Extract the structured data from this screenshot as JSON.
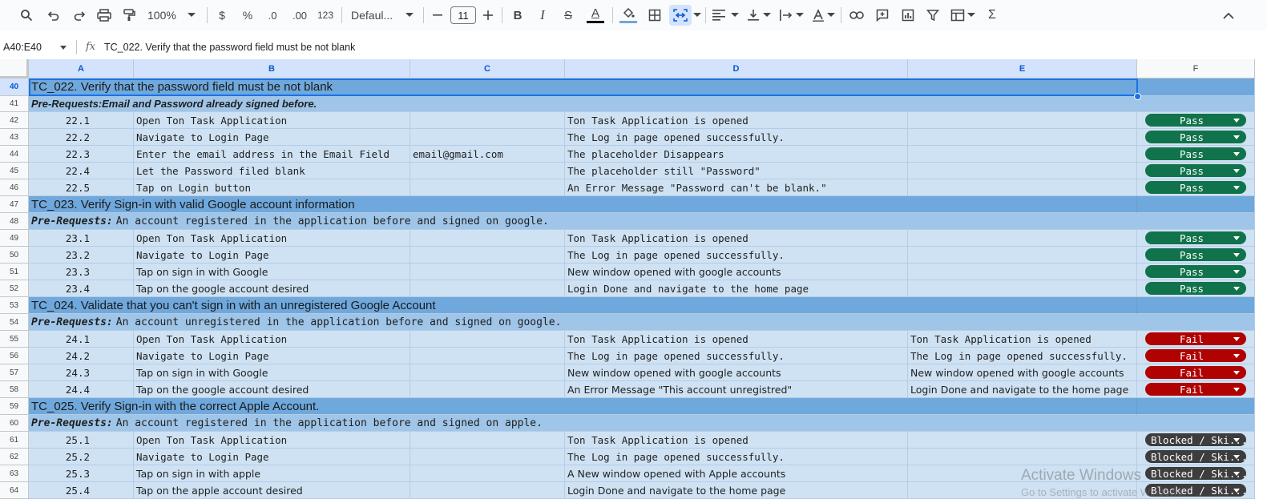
{
  "toolbar": {
    "zoom": "100%",
    "currency": "$",
    "percent": "%",
    "decrease_decimals": ".0",
    "increase_decimals": ".00",
    "number_format": "123",
    "font": "Defaul...",
    "font_size": "11",
    "bold": "B",
    "italic": "I",
    "strike": "S",
    "text_color": "A",
    "function": "Σ"
  },
  "formula_bar": {
    "name_box": "A40:E40",
    "fx": "fx",
    "content": "TC_022. Verify that the password field must be not blank"
  },
  "columns": [
    "A",
    "B",
    "C",
    "D",
    "E",
    "F"
  ],
  "rows": [
    {
      "num": "40",
      "type": "header",
      "title": "TC_022. Verify that the password field must be not blank"
    },
    {
      "num": "41",
      "type": "prereq",
      "label": "Pre-Requests:Email and Password already signed before.",
      "text": ""
    },
    {
      "num": "42",
      "type": "data",
      "a": "22.1",
      "b": "Open Ton Task Application",
      "c": "",
      "d": "Ton Task Application is opened",
      "e": "",
      "status": "Pass",
      "kind": "pass"
    },
    {
      "num": "43",
      "type": "data",
      "a": "22.2",
      "b": "Navigate to Login Page",
      "c": "",
      "d": "The Log in page opened successfully.",
      "e": "",
      "status": "Pass",
      "kind": "pass"
    },
    {
      "num": "44",
      "type": "data",
      "a": "22.3",
      "b": "Enter the email address in the Email Field",
      "c": "email@gmail.com",
      "d": "The placeholder Disappears",
      "e": "",
      "status": "Pass",
      "kind": "pass"
    },
    {
      "num": "45",
      "type": "data",
      "a": "22.4",
      "b": "Let the Password filed blank",
      "c": "",
      "d": "The placeholder still \"Password\"",
      "e": "",
      "status": "Pass",
      "kind": "pass"
    },
    {
      "num": "46",
      "type": "data",
      "a": "22.5",
      "b": "Tap on Login button",
      "c": "",
      "d": "An Error Message \"Password can't be blank.\"",
      "e": "",
      "status": "Pass",
      "kind": "pass"
    },
    {
      "num": "47",
      "type": "header",
      "title": "TC_023. Verify Sign-in with valid Google account information"
    },
    {
      "num": "48",
      "type": "prereq",
      "label": "Pre-Requests:",
      "text": "An account registered in the application before and signed on google."
    },
    {
      "num": "49",
      "type": "data",
      "a": "23.1",
      "b": "Open Ton Task Application",
      "c": "",
      "d": "Ton Task Application is opened",
      "e": "",
      "status": "Pass",
      "kind": "pass"
    },
    {
      "num": "50",
      "type": "data",
      "a": "23.2",
      "b": "Navigate to Login Page",
      "c": "",
      "d": "The Log in page opened successfully.",
      "e": "",
      "status": "Pass",
      "kind": "pass"
    },
    {
      "num": "51",
      "type": "data",
      "a": "23.3",
      "b": "Tap on sign in with Google",
      "c": "",
      "d": "New window opened with google accounts",
      "e": "",
      "status": "Pass",
      "kind": "pass",
      "font": "sans"
    },
    {
      "num": "52",
      "type": "data",
      "a": "23.4",
      "b": "Tap on the google account desired",
      "c": "",
      "d": "Login Done and navigate to the home page",
      "e": "",
      "status": "Pass",
      "kind": "pass",
      "font": "sansb"
    },
    {
      "num": "53",
      "type": "header",
      "title": "TC_024. Validate that you can't sign in with an unregistered Google Account"
    },
    {
      "num": "54",
      "type": "prereq",
      "label": "Pre-Requests:",
      "text": "An account unregistered in the application before and signed on google."
    },
    {
      "num": "55",
      "type": "data",
      "a": "24.1",
      "b": "Open Ton Task Application",
      "c": "",
      "d": "Ton Task Application is opened",
      "e": "Ton Task Application is opened",
      "status": "Fail",
      "kind": "fail"
    },
    {
      "num": "56",
      "type": "data",
      "a": "24.2",
      "b": "Navigate to Login Page",
      "c": "",
      "d": "The Log in page opened successfully.",
      "e": "The Log in page opened successfully.",
      "status": "Fail",
      "kind": "fail"
    },
    {
      "num": "57",
      "type": "data",
      "a": "24.3",
      "b": "Tap on sign in with Google",
      "c": "",
      "d": "New window opened with google accounts",
      "e": "New window opened with google accounts",
      "status": "Fail",
      "kind": "fail",
      "font": "sans"
    },
    {
      "num": "58",
      "type": "data",
      "a": "24.4",
      "b": "Tap on the google account desired",
      "c": "",
      "d": "An Error Message \"This account unregistred\"",
      "e": "Login Done and navigate to the home page",
      "status": "Fail",
      "kind": "fail",
      "font": "sans"
    },
    {
      "num": "59",
      "type": "header",
      "title": "TC_025. Verify Sign-in with the correct Apple Account."
    },
    {
      "num": "60",
      "type": "prereq",
      "label": "Pre-Requests:",
      "text": "An account registered in the application before and signed on apple."
    },
    {
      "num": "61",
      "type": "data",
      "a": "25.1",
      "b": "Open Ton Task Application",
      "c": "",
      "d": "Ton Task Application is opened",
      "e": "",
      "status": "Blocked / Ski...",
      "kind": "blocked"
    },
    {
      "num": "62",
      "type": "data",
      "a": "25.2",
      "b": "Navigate to Login Page",
      "c": "",
      "d": "The Log in page opened successfully.",
      "e": "",
      "status": "Blocked / Ski...",
      "kind": "blocked"
    },
    {
      "num": "63",
      "type": "data",
      "a": "25.3",
      "b": "Tap on sign in with apple",
      "c": "",
      "d": "A New window opened with Apple accounts",
      "e": "",
      "status": "Blocked / Ski...",
      "kind": "blocked",
      "font": "sans"
    },
    {
      "num": "64",
      "type": "data",
      "a": "25.4",
      "b": "Tap on the apple account desired",
      "c": "",
      "d": "Login Done and navigate to the home page",
      "e": "",
      "status": "Blocked / Ski...",
      "kind": "blocked",
      "font": "sans"
    }
  ],
  "watermark": {
    "line1": "Activate Windows",
    "line2": "Go to Settings to activate Windows."
  },
  "colors": {
    "header_fill": "#6fa8dc",
    "prereq_fill": "#9fc5e8",
    "data_fill": "#cfe2f3",
    "pass": "#11734b",
    "fail": "#b10202",
    "blocked": "#3d3d3d",
    "selection": "#1a73e8"
  }
}
